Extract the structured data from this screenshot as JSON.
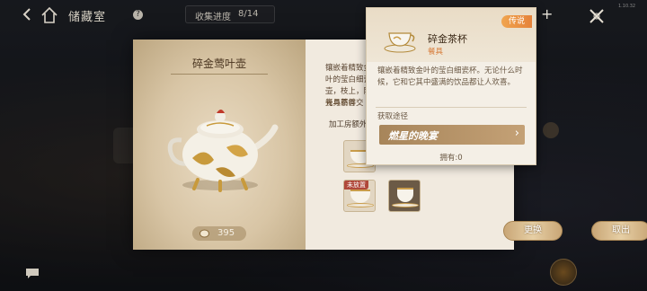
{
  "topbar": {
    "room_title": "储藏室",
    "help": "?",
    "progress_label": "收集进度",
    "progress_value": "8/14",
    "plus": "+",
    "version": "1.10.32"
  },
  "main_item": {
    "name": "碎金莺叶壶",
    "description": "镶嵌着精致金叶的莹白细瓷壶，枝上，阳光与茶香交织，日之中的惬意",
    "set_tag": "餐具羁绊",
    "bonus_label": "加工房额外",
    "price": "395"
  },
  "slots": [
    {
      "tag": ""
    },
    {
      "tag": ""
    },
    {
      "tag": "未放置"
    },
    {
      "tag": ""
    }
  ],
  "buttons": {
    "swap": "更换",
    "cancel": "取出"
  },
  "popup": {
    "rarity": "传说",
    "name": "碎金茶杯",
    "category": "餐具",
    "description": "镶嵌着精致金叶的莹白细瓷杯。无论什么时候，它和它其中盛满的饮品都让人欢喜。",
    "source_label": "获取途径",
    "source_name": "燃星的晚宴",
    "owned": "拥有:0"
  }
}
